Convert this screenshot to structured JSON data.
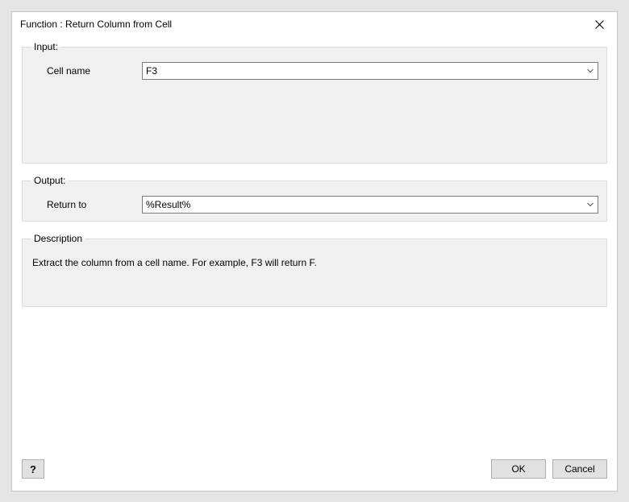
{
  "dialog": {
    "title": "Function : Return Column from Cell"
  },
  "input": {
    "legend": "Input:",
    "cell_name_label": "Cell name",
    "cell_name_value": "F3"
  },
  "output": {
    "legend": "Output:",
    "return_to_label": "Return to",
    "return_to_value": "%Result%"
  },
  "description": {
    "legend": "Description",
    "text": "Extract the column from a cell name. For example, F3 will return F."
  },
  "buttons": {
    "help": "?",
    "ok": "OK",
    "cancel": "Cancel"
  }
}
